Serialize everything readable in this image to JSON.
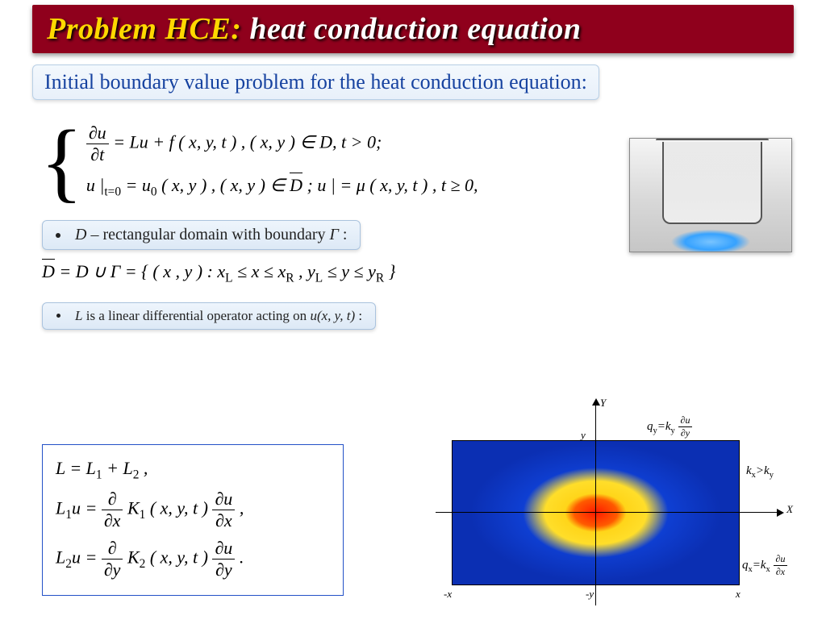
{
  "title": {
    "prefix": "Problem HCE:",
    "rest": " heat conduction equation"
  },
  "intro": "Initial boundary value problem for the heat conduction equation:",
  "system": {
    "line1": {
      "lhs_num": "∂u",
      "lhs_den": "∂t",
      "rhs": " = Lu + f ( x, y, t ) ,   ( x, y ) ∈ D,   t > 0;"
    },
    "line2": {
      "pre": "u |",
      "sub": "t=0",
      "mid": " = u",
      "sub0": "0",
      "rest": " ( x, y ) ,   ( x, y ) ∈ ",
      "dbar": "D",
      "tail": ";   u |   = μ ( x, y, t ) ,   t ≥ 0,"
    }
  },
  "note1": {
    "pre": "D",
    " text": " – rectangular domain with boundary  ",
    "gamma": "Γ",
    " tail": " :"
  },
  "domain_eq": {
    "dbar": "D",
    "rest": " = D ∪ Γ  = { ( x , y ) :   x",
    "subL": "L",
    "mid1": " ≤ x ≤ x",
    "subR": "R",
    "mid2": " ,   y",
    "subL2": "L",
    "mid3": " ≤ y ≤ y",
    "subR2": "R",
    "end": " }"
  },
  "note2": {
    "pre": "L",
    "text1": "  is a linear differential operator acting on ",
    "func": "u(x, y, t)",
    "tail": " :"
  },
  "operator_box": {
    "row1": {
      "a": "L = L",
      "s1": "1",
      "b": " + L",
      "s2": "2",
      "c": " ,"
    },
    "row2": {
      "a": "L",
      "s1": "1",
      "b": "u = ",
      "dd": "∂",
      "dx": "∂x",
      "k": " K",
      "ks": "1",
      "args": " ( x, y, t ) ",
      "du": "∂u",
      "dx2": "∂x",
      "end": " ,"
    },
    "row3": {
      "a": "L",
      "s1": "2",
      "b": "u = ",
      "dd": "∂",
      "dy": "∂y",
      "k": " K",
      "ks": "2",
      "args": " ( x, y, t ) ",
      "du": "∂u",
      "dy2": "∂y",
      "end": " ."
    }
  },
  "figure": {
    "Y": "Y",
    "X": "X",
    "y": "y",
    "x": "x",
    "mx": "-x",
    "my": "-y",
    "qy": {
      "a": "q",
      "sy": "y",
      "eq": "=k",
      "sky": "y",
      "du": "∂u",
      "dd": "∂y"
    },
    "qx": {
      "a": "q",
      "sx": "x",
      "eq": "=k",
      "skx": "x",
      "du": "∂u",
      "dd": "∂x"
    },
    "cond": {
      "a": "k",
      "sx": "x",
      "gt": ">k",
      "sy": "y"
    }
  }
}
